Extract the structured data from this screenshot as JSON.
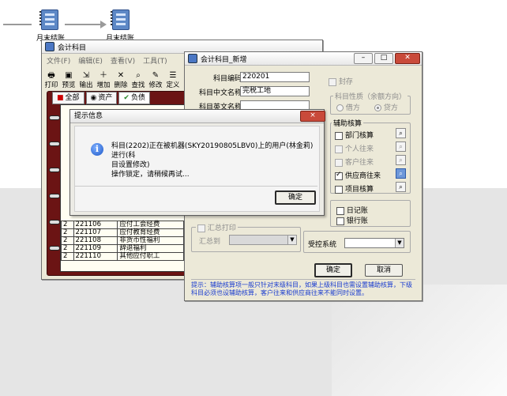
{
  "desktop": {
    "icons": [
      {
        "label": "月末结账",
        "icon": "ledger-book-icon"
      },
      {
        "label": "月末结账",
        "icon": "ledger-book-icon"
      }
    ]
  },
  "accounts_window": {
    "title": "会计科目",
    "menu": [
      "文件(F)",
      "编辑(E)",
      "查看(V)",
      "工具(T)"
    ],
    "toolbar": [
      "打印",
      "预览",
      "输出",
      "增加",
      "删除",
      "查找",
      "修改",
      "定义"
    ],
    "tabs": [
      "全部",
      "资产",
      "负债"
    ],
    "rows": [
      {
        "level": "2",
        "code": "221106",
        "name": "应付工会经费"
      },
      {
        "level": "2",
        "code": "221107",
        "name": "应付教育经费"
      },
      {
        "level": "2",
        "code": "221108",
        "name": "非货币性福利"
      },
      {
        "level": "2",
        "code": "221109",
        "name": "辞退福利"
      },
      {
        "level": "2",
        "code": "221110",
        "name": "其他应付职工"
      }
    ]
  },
  "new_account_window": {
    "title": "会计科目_新增",
    "code_label": "科目编码",
    "code_value": "220201",
    "cn_name_label": "科目中文名称",
    "cn_name_value": "完税工地",
    "en_name_label": "科目英文名称",
    "sealed_label": "封存",
    "nature_group": "科目性质（余额方向）",
    "debit_label": "借方",
    "credit_label": "贷方",
    "aux_group": "辅助核算",
    "aux_items": [
      {
        "label": "部门核算",
        "checked": false,
        "enabled": true
      },
      {
        "label": "个人往来",
        "checked": false,
        "enabled": false
      },
      {
        "label": "客户往来",
        "checked": false,
        "enabled": false
      },
      {
        "label": "供应商往来",
        "checked": true,
        "enabled": true
      },
      {
        "label": "项目核算",
        "checked": false,
        "enabled": true
      }
    ],
    "journal_label": "日记账",
    "bank_label": "银行账",
    "summary_print_label": "汇总打印",
    "summary_to_label": "汇总到",
    "system_label": "受控系统",
    "ok_label": "确定",
    "cancel_label": "取消",
    "hint": "提示：辅助核算项一般只针对末级科目，如果上级科目也需设置辅助核算，下级科目必须也设辅助核算，客户往来和供应商往来不能同时设置。"
  },
  "message_box": {
    "title": "提示信息",
    "close_label": "×",
    "message_line1": "科目(2202)正在被机器(SKY20190805LBV0)上的用户(林金莉)进行(科",
    "message_line2": "目设置修改)",
    "message_line3": "操作锁定，请稍候再试...",
    "ok_label": "确定"
  }
}
